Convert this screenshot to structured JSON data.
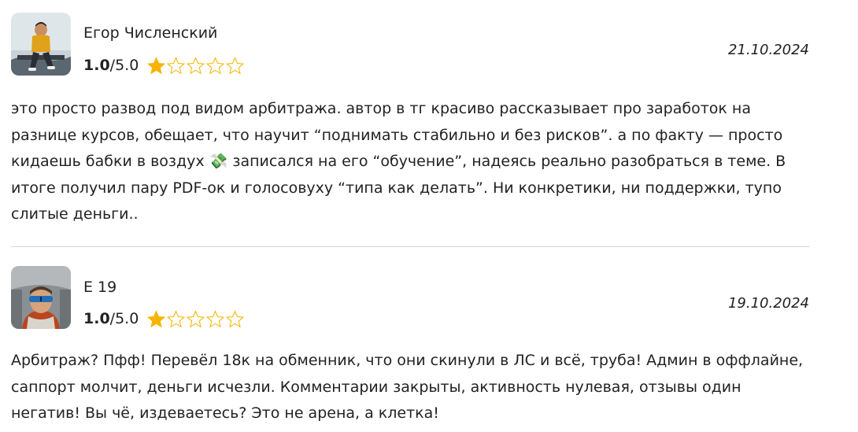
{
  "reviews": [
    {
      "author": "Егор Численский",
      "rating_value": "1.0",
      "rating_max": "/5.0",
      "stars_filled": 1,
      "stars_total": 5,
      "date": "21.10.2024",
      "avatar_icon": "user-avatar-photo",
      "text": "это просто развод под видом арбитража. автор в тг красиво рассказывает про заработок на разнице курсов, обещает, что научит “поднимать стабильно и без рисков”. а по факту — просто кидаешь бабки в воздух 💸 записался на его “обучение”, надеясь реально разобраться в теме. В итоге получил пару PDF-ок и голосовуху “типа как делать”. Ни конкретики, ни поддержки, тупо слитые деньги.."
    },
    {
      "author": "E 19",
      "rating_value": "1.0",
      "rating_max": "/5.0",
      "stars_filled": 1,
      "stars_total": 5,
      "date": "19.10.2024",
      "avatar_icon": "user-avatar-photo",
      "text": "Арбитраж? Пфф! Перевёл 18к на обменник, что они скинули в ЛС и всё, труба! Админ в оффлайне, саппорт молчит, деньги исчезли. Комментарии закрыты, активность нулевая, отзывы один негатив! Вы чё, издеваетесь? Это не арена, а клетка!"
    }
  ],
  "colors": {
    "star": "#f5b500",
    "text": "#222222",
    "divider": "#d5d5d5"
  }
}
